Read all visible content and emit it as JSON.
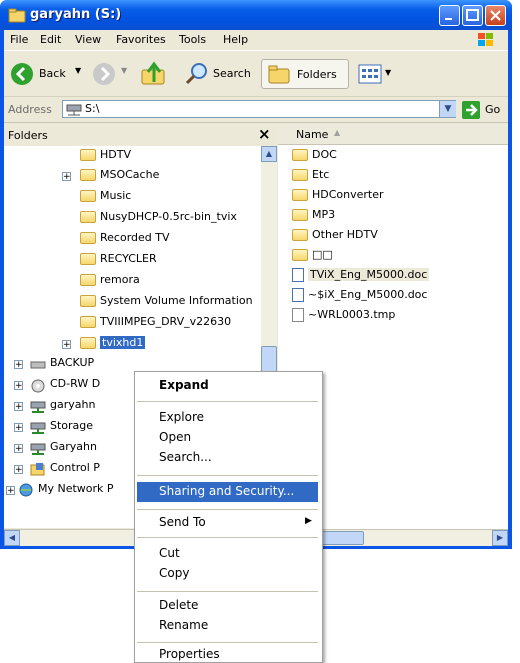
{
  "window": {
    "title": "garyahn (S:)",
    "colors": {
      "titlebar": "#0054e3",
      "selection": "#316ac5",
      "face": "#ece9d8"
    }
  },
  "menubar": {
    "items": [
      "File",
      "Edit",
      "View",
      "Favorites",
      "Tools",
      "Help"
    ]
  },
  "toolbar": {
    "back_label": "Back",
    "search_label": "Search",
    "folders_label": "Folders"
  },
  "address": {
    "label": "Address",
    "value": "S:\\",
    "go_label": "Go"
  },
  "folders_pane": {
    "header": "Folders",
    "close_glyph": "×",
    "items": [
      {
        "label": "HDTV",
        "expander": ""
      },
      {
        "label": "MSOCache",
        "expander": "+"
      },
      {
        "label": "Music",
        "expander": ""
      },
      {
        "label": "NusyDHCP-0.5rc-bin_tvix",
        "expander": ""
      },
      {
        "label": "Recorded TV",
        "expander": ""
      },
      {
        "label": "RECYCLER",
        "expander": ""
      },
      {
        "label": "remora",
        "expander": ""
      },
      {
        "label": "System Volume Information",
        "expander": ""
      },
      {
        "label": "TVIIIMPEG_DRV_v22630",
        "expander": ""
      },
      {
        "label": "tvixhd1",
        "expander": "+",
        "selected": true
      }
    ],
    "drives": [
      {
        "label": "BACKUP",
        "icon": "drive-icon"
      },
      {
        "label": "CD-RW D",
        "icon": "cd-icon"
      },
      {
        "label": "garyahn",
        "icon": "network-drive-icon"
      },
      {
        "label": "Storage",
        "icon": "network-drive-icon"
      },
      {
        "label": "Garyahn",
        "icon": "network-drive-icon"
      },
      {
        "label": "Control P",
        "icon": "control-panel-icon"
      },
      {
        "label": "My Network P",
        "icon": "network-places-icon"
      }
    ]
  },
  "files_pane": {
    "column_name": "Name",
    "items": [
      {
        "label": "DOC",
        "type": "folder"
      },
      {
        "label": "Etc",
        "type": "folder"
      },
      {
        "label": "HDConverter",
        "type": "folder"
      },
      {
        "label": "MP3",
        "type": "folder"
      },
      {
        "label": "Other HDTV",
        "type": "folder"
      },
      {
        "label": "□□",
        "type": "folder"
      },
      {
        "label": "TViX_Eng_M5000.doc",
        "type": "doc"
      },
      {
        "label": "~$iX_Eng_M5000.doc",
        "type": "doc"
      },
      {
        "label": "~WRL0003.tmp",
        "type": "tmp"
      }
    ]
  },
  "context_menu": {
    "expand": "Expand",
    "explore": "Explore",
    "open": "Open",
    "search": "Search...",
    "sharing": "Sharing and Security...",
    "send_to": "Send To",
    "cut": "Cut",
    "copy": "Copy",
    "delete": "Delete",
    "rename": "Rename",
    "properties": "Properties"
  }
}
